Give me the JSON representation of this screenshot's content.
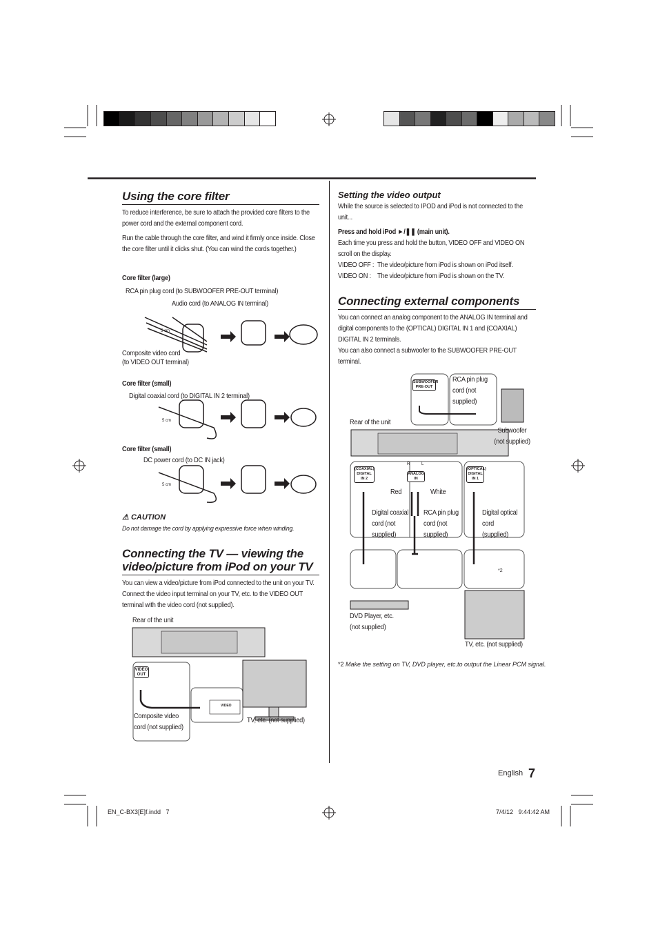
{
  "colors": {
    "left_bar": [
      "#000000",
      "#1a1a1a",
      "#333333",
      "#4d4d4d",
      "#666666",
      "#808080",
      "#999999",
      "#b3b3b3",
      "#cccccc",
      "#e6e6e6",
      "#ffffff"
    ],
    "right_bar": [
      "#e6e6e6",
      "#555555",
      "#777777",
      "#222222",
      "#4d4d4d",
      "#6b6b6b",
      "#000000",
      "#eeeeee",
      "#aaaaaa",
      "#bbbbbb",
      "#888888"
    ]
  },
  "core_filter": {
    "title": "Using the core filter",
    "para1": "To reduce interference, be sure to attach the provided core filters to the power cord and the external component cord.",
    "para2": "Run the cable through the core filter, and wind it firmly once inside. Close the core filter until it clicks shut. (You can wind the cords together.)",
    "large": {
      "heading": "Core filter (large)",
      "label_rca": "RCA pin plug cord (to SUBWOOFER PRE-OUT terminal)",
      "label_audio": "Audio cord (to ANALOG IN terminal)",
      "label_composite": "Composite video cord",
      "label_composite2": "(to VIDEO OUT terminal)",
      "dim": "5 cm"
    },
    "small1": {
      "heading": "Core filter (small)",
      "label": "Digital coaxial cord (to DIGITAL IN 2 terminal)",
      "dim": "5 cm"
    },
    "small2": {
      "heading": "Core filter (small)",
      "label": "DC power cord (to DC IN jack)",
      "dim": "5 cm"
    },
    "caution_title": "CAUTION",
    "caution_text": "Do not damage the cord by applying expressive force when winding."
  },
  "tv": {
    "title_line1": "Connecting the TV — viewing the",
    "title_line2": "video/picture from iPod on your TV",
    "para": "You can view a video/picture from iPod connected to the unit on your TV. Connect the video input terminal on your TV, etc. to the VIDEO OUT terminal with the video cord (not supplied).",
    "rear_label": "Rear of the unit",
    "video_out": "VIDEO OUT",
    "cord_label": "Composite video cord (not supplied)",
    "video_jack": "VIDEO",
    "tv_label": "TV, etc. (not supplied)"
  },
  "video_output": {
    "title": "Setting the video output",
    "intro": "While the source is selected to IPOD and iPod is not connected to the unit...",
    "instruction": "Press and hold iPod ►/❚❚ (main unit).",
    "desc": "Each time you press and hold the button, VIDEO OFF and VIDEO ON scroll on the display.",
    "rows": [
      {
        "term": "VIDEO OFF :",
        "def": "The video/picture from iPod is shown on iPod itself."
      },
      {
        "term": "VIDEO ON :",
        "def": "The video/picture from iPod is shown on the TV."
      }
    ]
  },
  "external": {
    "title": "Connecting external components",
    "para1": "You can connect an analog component to the ANALOG IN terminal and digital components to the (OPTICAL) DIGITAL IN 1 and (COAXIAL) DIGITAL IN 2 terminals.",
    "para2": "You can also connect a subwoofer to the SUBWOOFER PRE-OUT terminal.",
    "sub_preout": "SUBWOOFER PRE-OUT",
    "rca_sub": "RCA pin plug cord (not supplied)",
    "rear_label": "Rear of the unit",
    "subwoofer": "Subwoofer (not supplied)",
    "coaxial": "(COAXIAL) DIGITAL IN 2",
    "analog": "ANALOG IN",
    "optical": "(OPTICAL) DIGITAL IN 1",
    "r": "R",
    "l": "L",
    "red": "Red",
    "white": "White",
    "coax_cord": "Digital coaxial cord (not supplied)",
    "rca_cord": "RCA pin plug cord (not supplied)",
    "optical_cord": "Digital optical cord (supplied)",
    "note_mark": "*2",
    "dvd": "DVD Player, etc. (not supplied)",
    "tv": "TV, etc. (not supplied)",
    "footnote_mark": "*2",
    "footnote": "Make the setting on TV, DVD player, etc.to output the Linear PCM signal."
  },
  "footer": {
    "language": "English",
    "page": "7",
    "file": "EN_C-BX3[E]f.indd   7",
    "timestamp": "7/4/12   9:44:42 AM"
  }
}
